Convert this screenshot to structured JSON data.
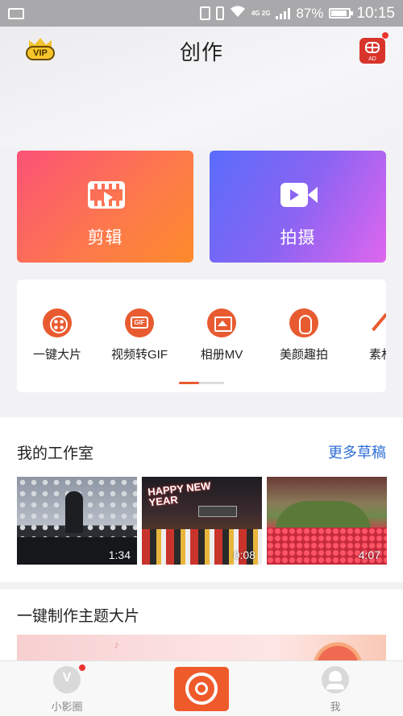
{
  "status_bar": {
    "network": "4G 2G",
    "battery_percent": "87%",
    "battery_level": 0.87,
    "time": "10:15"
  },
  "header": {
    "title": "创作",
    "vip_label": "VIP",
    "ad_label": "AD"
  },
  "cards": {
    "edit_label": "剪辑",
    "shoot_label": "拍摄"
  },
  "tools": [
    {
      "label": "一键大片",
      "icon": "one-key-icon"
    },
    {
      "label": "视频转GIF",
      "icon": "gif-icon",
      "icon_text": "GIF"
    },
    {
      "label": "相册MV",
      "icon": "album-icon"
    },
    {
      "label": "美颜趣拍",
      "icon": "beauty-icon"
    },
    {
      "label": "素材",
      "icon": "material-wand-icon"
    }
  ],
  "studio": {
    "title": "我的工作室",
    "more_link": "更多草稿",
    "drafts": [
      {
        "duration": "1:34"
      },
      {
        "duration": "0:08",
        "overlay_text": "HAPPY NEW YEAR"
      },
      {
        "duration": "4:07"
      }
    ]
  },
  "theme": {
    "title": "一键制作主题大片"
  },
  "tab_bar": {
    "circle_label": "小影圈",
    "me_label": "我"
  },
  "colors": {
    "accent": "#ef5a2b",
    "link": "#2f6fd8",
    "edit_card_gradient": [
      "#fb5277",
      "#fd8b2b"
    ],
    "shoot_card_gradient": [
      "#5a6cfb",
      "#e066ee"
    ]
  }
}
